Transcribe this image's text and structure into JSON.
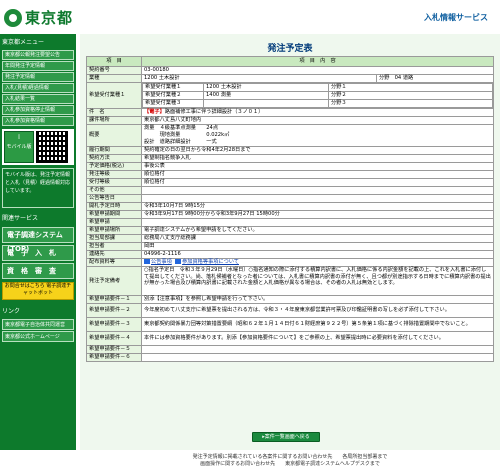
{
  "header": {
    "logo_text": "東京都",
    "service_name": "入札情報サービス"
  },
  "sidebar": {
    "title": "東京都メニュー",
    "items": [
      "東京都公報発注要望公告",
      "年間発注予定情報",
      "発注予定情報",
      "入札(見積)経過情報",
      "入札結果一覧",
      "入札参加資格停止情報",
      "入札参加資格情報"
    ],
    "mobile_label": "モバイル版",
    "qr_note": "モバイル版は、発注予定情報と入札（見積）経過情報対応しています。",
    "section2": "関連サービス",
    "big_links": [
      "電子調達システム(TOP)",
      "電　子　入　札",
      "資　格　審　査"
    ],
    "yellow": "お問合せはこちら 電子調達チャットボット",
    "links_title": "リンク",
    "links": [
      "東京都電子自治体共同運営",
      "東京都公式ホームページ"
    ]
  },
  "main": {
    "page_title": "発注予定表",
    "col_item": "項　目",
    "col_content": "項　目　内　容",
    "rows": [
      {
        "label": "契約番号",
        "value": "03-00180"
      },
      {
        "label": "業種",
        "value": "1200 土木設計",
        "extra_label": "分野",
        "extra_value": "04 道路"
      },
      {
        "label": "件　名",
        "value_red": "【電子】",
        "value": "路面補修工事に伴う詳細設計（３ノ０１）"
      },
      {
        "label": "課件場所",
        "value": "東京都八丈島八丈町地内"
      },
      {
        "label": "履行期間",
        "value": "契約確定の日の翌日から令和4年2月28日まで"
      },
      {
        "label": "契約方法",
        "value": "希望制指名競争入札"
      },
      {
        "label": "予定価格(税込)",
        "value": "事後公表"
      },
      {
        "label": "発注等級",
        "value": "順位格付"
      },
      {
        "label": "受付等級",
        "value": "順位格付"
      },
      {
        "label": "その他",
        "value": ""
      },
      {
        "label": "公告等告日",
        "value": ""
      },
      {
        "label": "開札予定日時",
        "value": "令和3年10月7日 9時15分"
      },
      {
        "label": "希望申請期間",
        "value": "令和3年9月17日 9時00分から令和3年9月27日 15時00分"
      },
      {
        "label": "希望申請",
        "value": ""
      },
      {
        "label": "希望申請場所",
        "value": "電子調達システムから希望申請をしてください。"
      },
      {
        "label": "担当局部課",
        "value": "総務局八丈支庁総務課"
      },
      {
        "label": "担当者",
        "value": "岡田"
      },
      {
        "label": "連絡先",
        "value": "04996-2-1116"
      }
    ],
    "desired": [
      {
        "label": "希望受付業種１",
        "value": "1200 土木設計",
        "sub": "分野１"
      },
      {
        "label": "希望受付業種２",
        "value": "1400 測量",
        "sub": "分野２"
      },
      {
        "label": "希望受付業種３",
        "value": "",
        "sub": "分野３"
      }
    ],
    "overview_label": "概要",
    "overview": [
      "測量　４級基準点測量　　24点",
      "　　　現地測量　　　　　0.022k㎡",
      "設計　道路詳細設計　　　一式"
    ],
    "docs_label": "配布資料等",
    "docs": [
      "公告事項",
      "参加資格等事項について"
    ],
    "supplement_label": "発注予定備考",
    "supplement": "○指名予定日　令和３年９月29日（水曜日）○指名通知の際に添付する積算内訳書に、入札価格に係る内訳金額を記載の上、これを入札書に添付して提出してください。尚、落札候補者となった者については、入札書に積算内訳書の添付が無く、且つ都が別途指示する日時までに積算内訳書の提出が無かった場合及び積算内訳書に記載された金額と入札価格が異なる場合は、その者の入札は無効とします。",
    "conditions": [
      {
        "label": "希望申請要件－１",
        "value": "別添【注意事項】を参照し希望申請を行って下さい。"
      },
      {
        "label": "希望申請要件－２",
        "value": "今年度初めて八丈支庁に希望票を提出される方は、令和３・４年度東京都営業許可票及び印鑑証明書の写しを必ず添付して下さい。"
      },
      {
        "label": "希望申請要件－３",
        "value": "東京都契約関係暴力団等対策措置要綱（昭和６２年１月１４日付６１財経庶第９２２号）第５条第１項に基づく排除措置期間中でないこと。"
      },
      {
        "label": "希望申請要件－４",
        "value": "本件には参加資格要件があります。別添【参加資格要件について】をご参照の上、希望票提出時に必要資料を添付してください。"
      },
      {
        "label": "希望申請要件－５",
        "value": ""
      },
      {
        "label": "希望申請要件－６",
        "value": ""
      }
    ],
    "back_button": "案件一覧画面へ戻る",
    "footer_lines": [
      "発注予定情報に掲載されている各案件に関するお問い合わせ先　　各局所担当部署まで",
      "画面操作に関するお問い合わせ先　　東京都電子調達システムヘルプデスクまで"
    ]
  }
}
